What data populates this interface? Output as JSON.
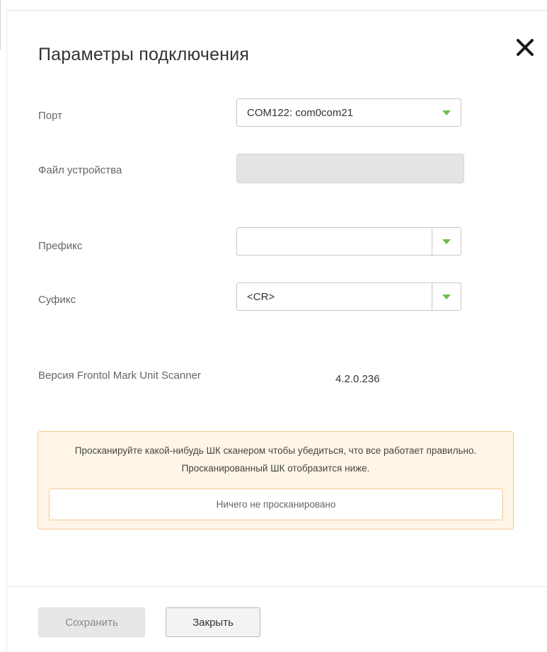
{
  "dialog": {
    "title": "Параметры подключения",
    "close_icon": "close-icon"
  },
  "fields": {
    "port": {
      "label": "Порт",
      "value": "COM122: com0com21"
    },
    "device_file": {
      "label": "Файл устройства",
      "value": ""
    },
    "prefix": {
      "label": "Префикс",
      "value": ""
    },
    "suffix": {
      "label": "Суфикс",
      "value": "<CR>"
    }
  },
  "version": {
    "label": "Версия Frontol Mark Unit Scanner",
    "value": "4.2.0.236"
  },
  "notice": {
    "text": "Просканируйте какой-нибудь ШК сканером чтобы убедиться, что все работает правильно. Просканированный ШК отобразится ниже.",
    "scan_result": "Ничего не просканировано"
  },
  "buttons": {
    "save": "Сохранить",
    "close": "Закрыть"
  },
  "colors": {
    "accent_arrow": "#6cc04a",
    "notice_bg": "#fff6e8",
    "notice_border": "#f4c98c"
  }
}
